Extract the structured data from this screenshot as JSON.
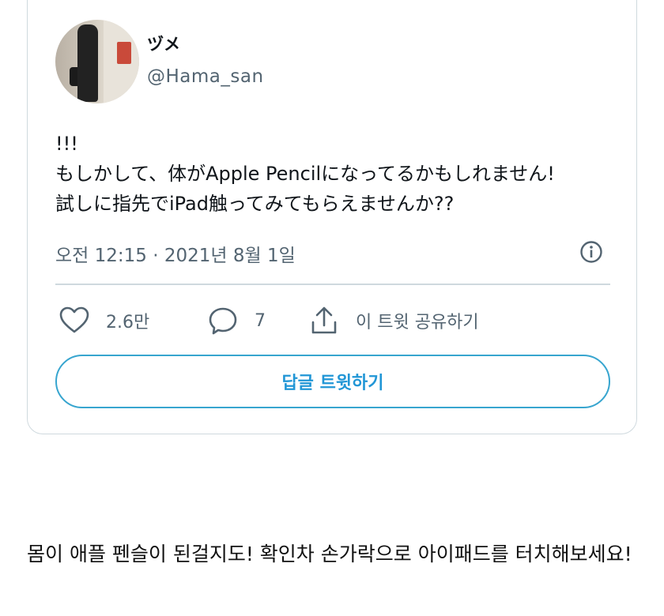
{
  "tweet": {
    "author_name": "ヅメ",
    "author_handle": "@Hama_san",
    "text": "!!!\nもしかして、体がApple Pencilになってるかもしれません!\n試しに指先でiPad触ってみてもらえませんか??",
    "timestamp": "오전 12:15 · 2021년 8월 1일"
  },
  "actions": {
    "like_icon": "heart-icon",
    "like_count": "2.6만",
    "reply_icon": "comment-icon",
    "reply_count": "7",
    "share_icon": "share-icon",
    "share_label": "이 트윗 공유하기",
    "info_icon": "info-icon"
  },
  "reply_button": {
    "label": "답글 트윗하기"
  },
  "caption": "몸이 애플 펜슬이 된걸지도! 확인차 손가락으로 아이패드를 터치해보세요!",
  "colors": {
    "accent": "#1d9bf0",
    "muted": "#536471",
    "border": "#cfd9de"
  }
}
